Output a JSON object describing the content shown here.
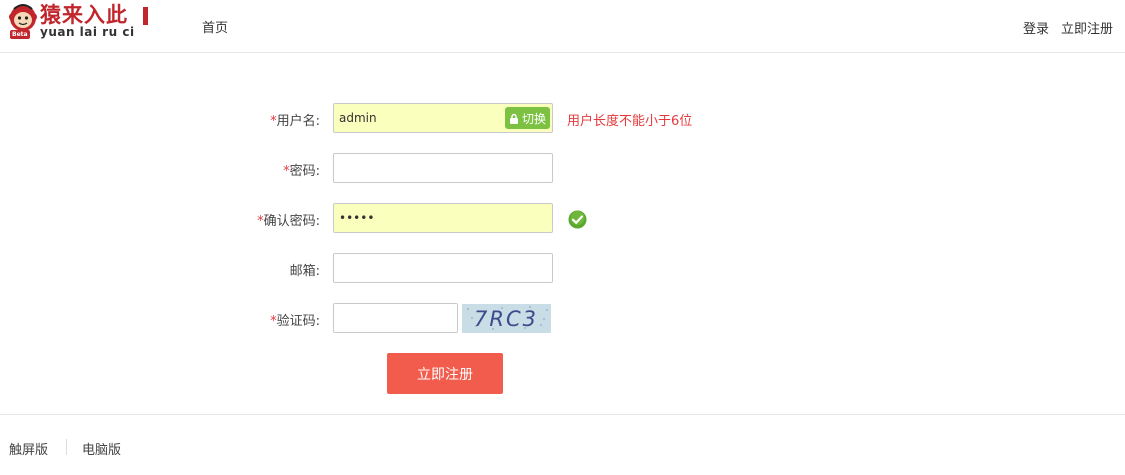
{
  "header": {
    "logo": {
      "title": "猿来入此",
      "subtitle": "yuan lai ru ci",
      "beta": "Beta"
    },
    "nav_home": "首页",
    "login": "登录",
    "register": "立即注册"
  },
  "form": {
    "required_mark": "*",
    "username": {
      "label": "用户名:",
      "value": "admin",
      "switch_label": "切换",
      "error": "用户长度不能小于6位"
    },
    "password": {
      "label": "密码:",
      "value": ""
    },
    "confirm_password": {
      "label": "确认密码:",
      "value": "•••••"
    },
    "email": {
      "label": "邮箱:",
      "value": ""
    },
    "captcha": {
      "label": "验证码:",
      "value": "",
      "image_text": "7RC3"
    },
    "submit_label": "立即注册"
  },
  "footer": {
    "touch": "触屏版",
    "pc": "电脑版"
  },
  "colors": {
    "brand_red": "#c0262c",
    "error": "#e4393c",
    "submit_bg": "#f15c4c",
    "autofill_bg": "#fbffbd",
    "switch_green": "#7cc142",
    "ok_green": "#5aa92e"
  }
}
